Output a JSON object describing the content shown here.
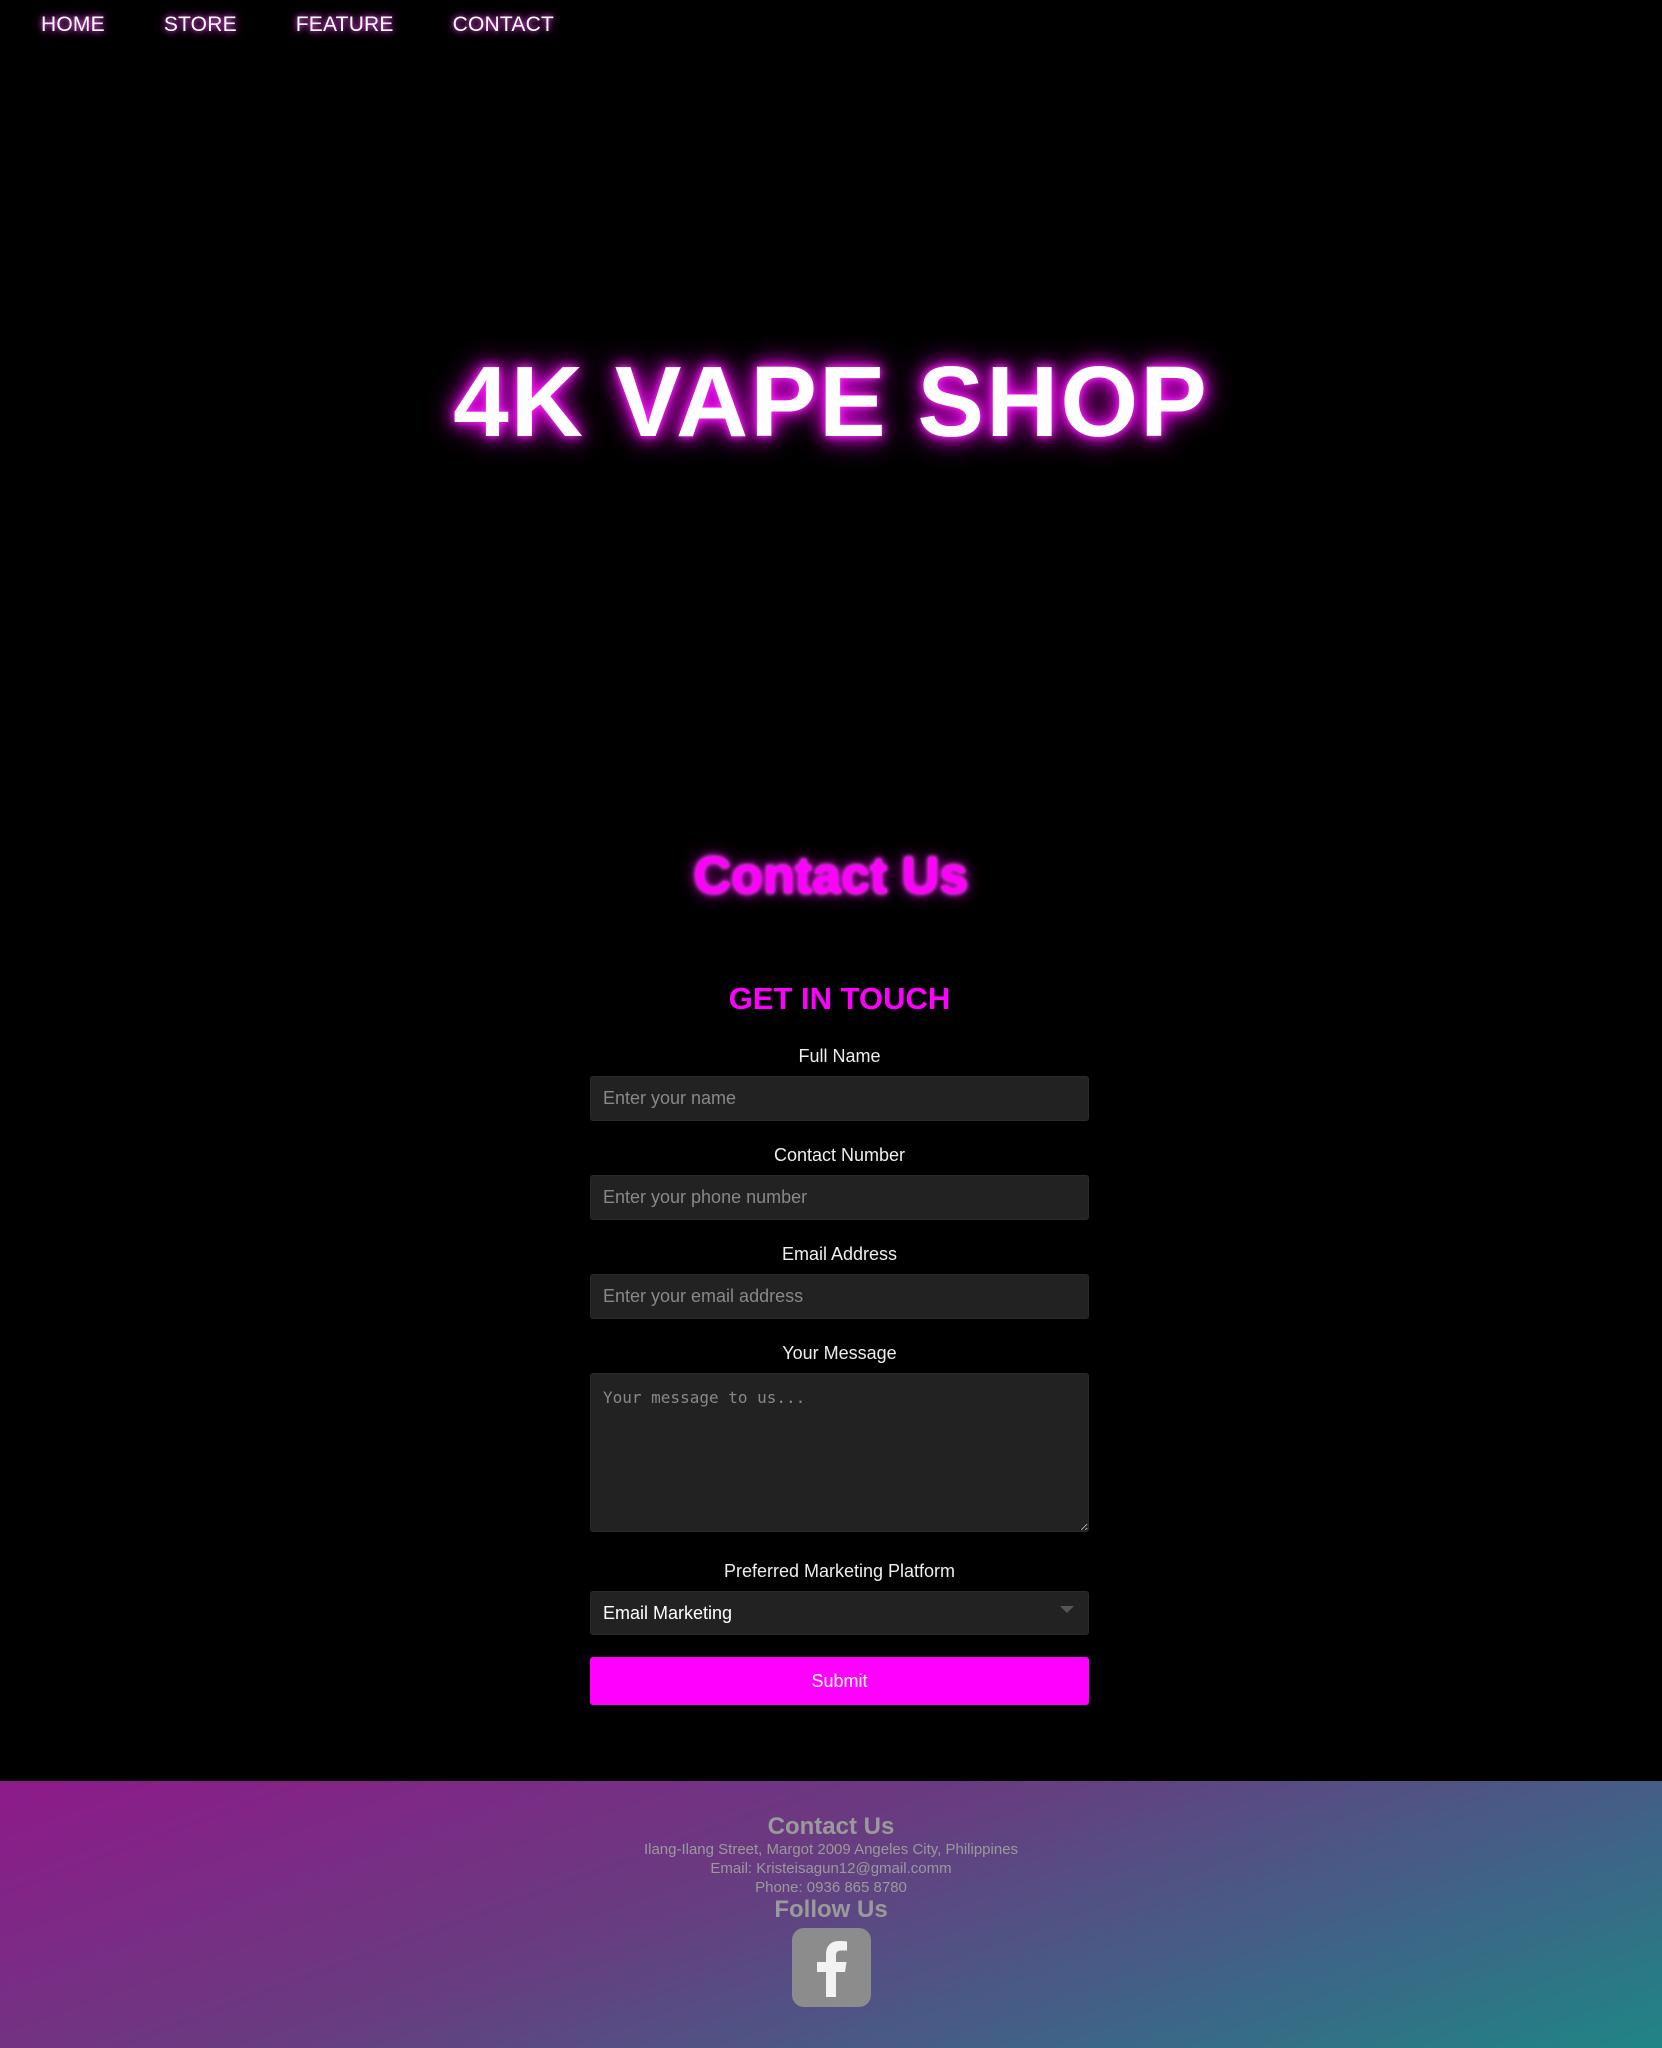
{
  "nav": {
    "items": [
      {
        "label": "HOME"
      },
      {
        "label": "STORE"
      },
      {
        "label": "FEATURE"
      },
      {
        "label": "CONTACT"
      }
    ]
  },
  "hero": {
    "title": "4K VAPE SHOP"
  },
  "contact": {
    "heading": "Contact Us",
    "form_title": "GET IN TOUCH",
    "fields": {
      "name": {
        "label": "Full Name",
        "placeholder": "Enter your name",
        "value": ""
      },
      "phone": {
        "label": "Contact Number",
        "placeholder": "Enter your phone number",
        "value": ""
      },
      "email": {
        "label": "Email Address",
        "placeholder": "Enter your email address",
        "value": ""
      },
      "message": {
        "label": "Your Message",
        "placeholder": "Your message to us...",
        "value": ""
      },
      "platform": {
        "label": "Preferred Marketing Platform",
        "selected": "Email Marketing"
      }
    },
    "submit_label": "Submit"
  },
  "footer": {
    "contact_title": "Contact Us",
    "address": "Ilang-Ilang Street, Margot 2009 Angeles City, Philippines",
    "email": "Email: Kristeisagun12@gmail.comm",
    "phone": "Phone: 0936 865 8780",
    "follow_title": "Follow Us",
    "social_icon": "facebook-icon"
  },
  "colors": {
    "accent": "#ff00ff",
    "background": "#000000",
    "field_bg": "#222222"
  }
}
